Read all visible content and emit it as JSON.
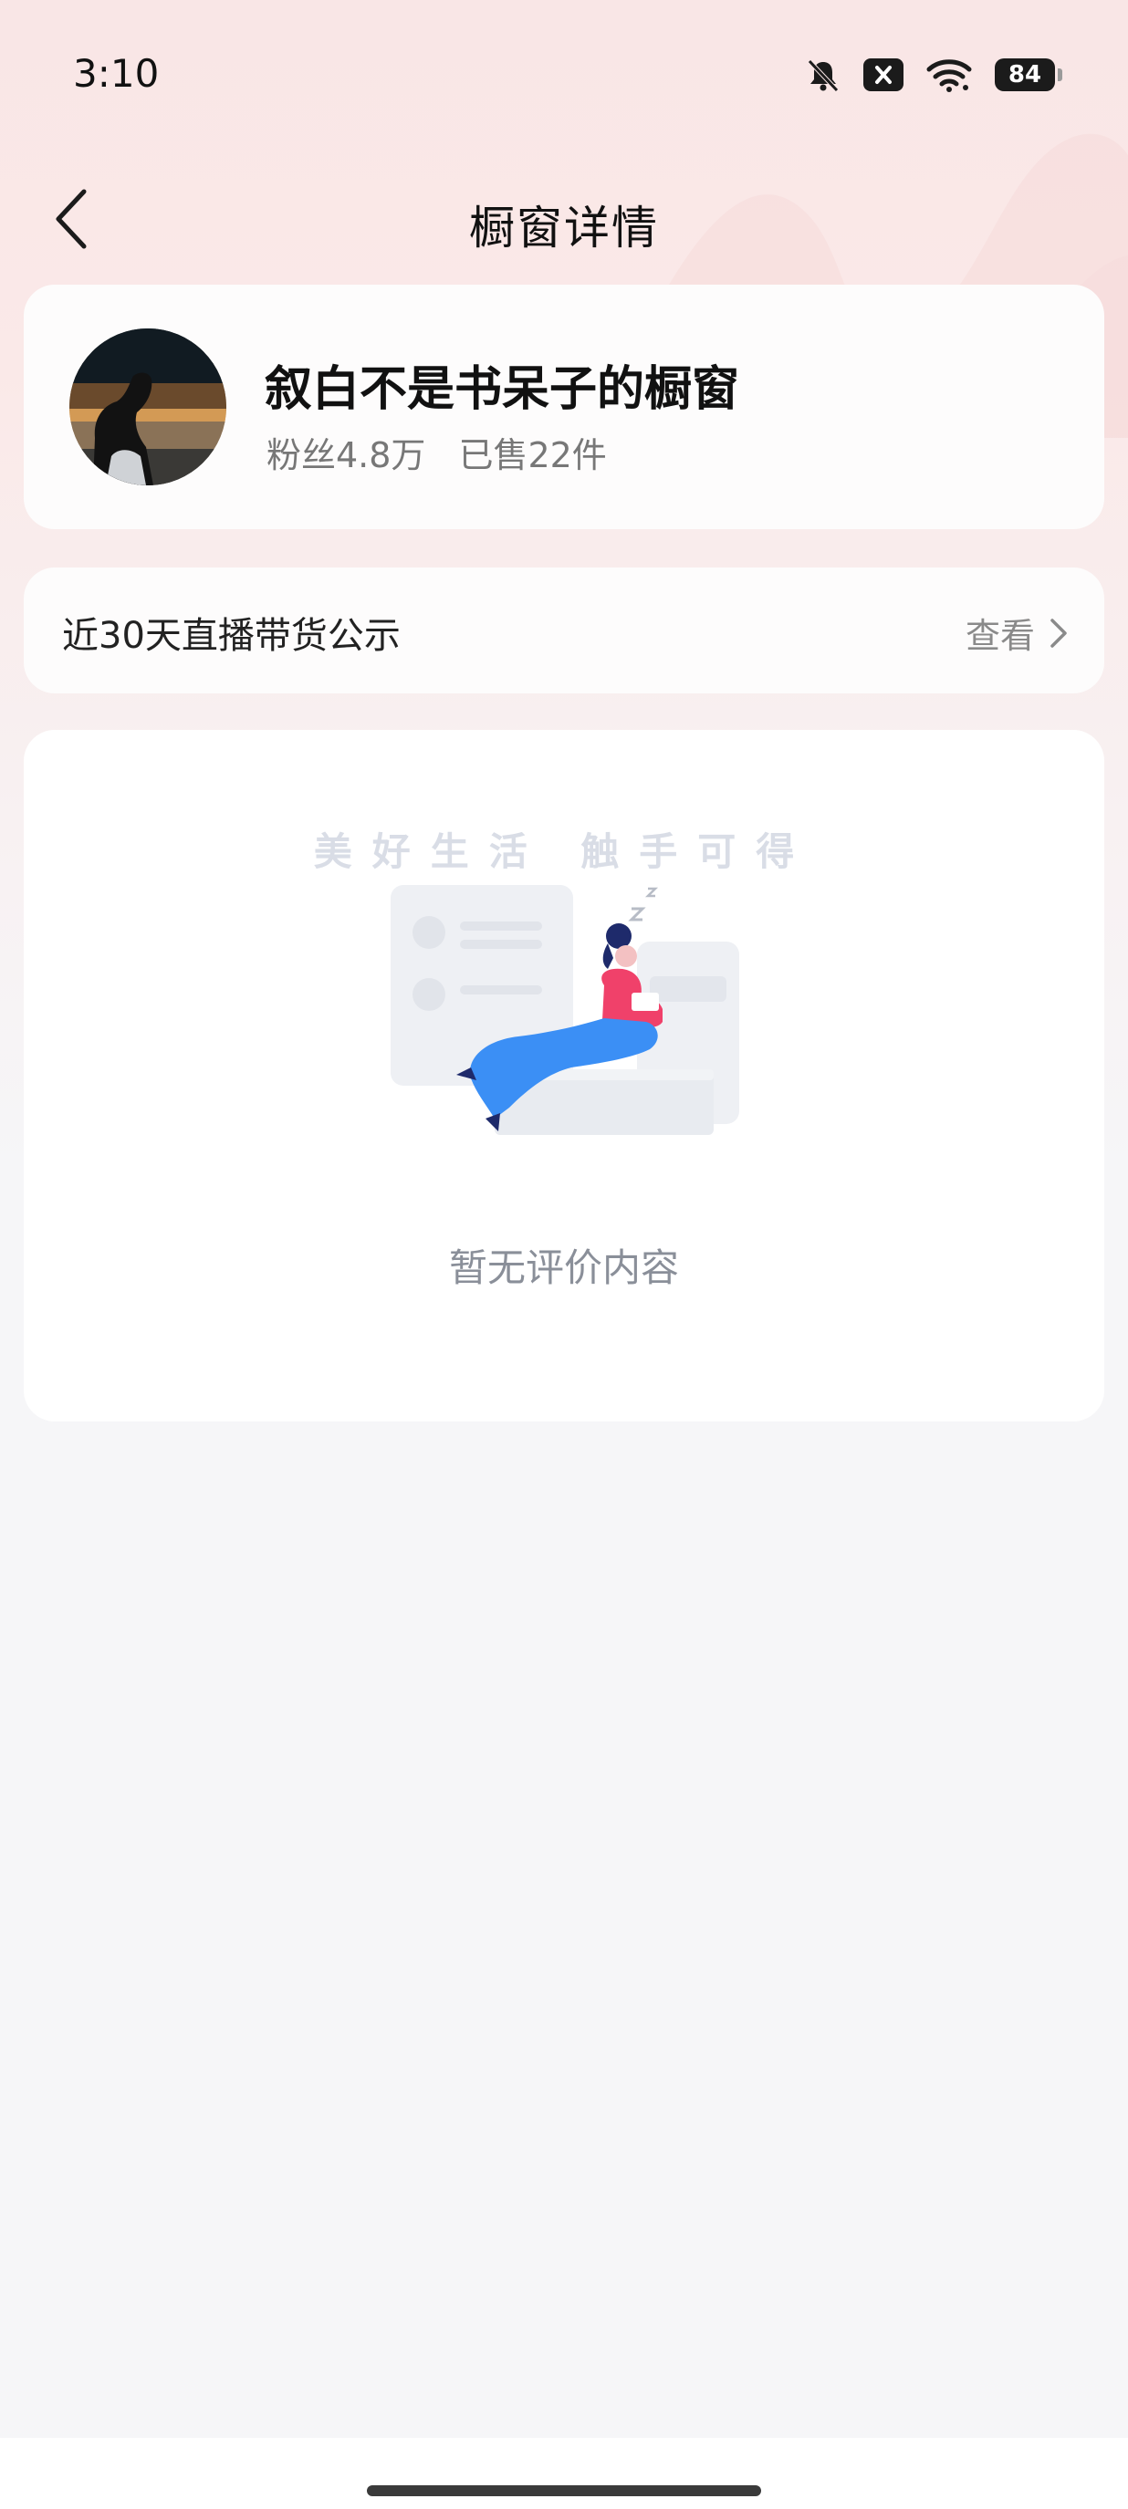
{
  "status_bar": {
    "time": "3:10",
    "battery": "84",
    "icons": [
      "bell-muted-icon",
      "close-box-icon",
      "wifi-icon",
      "battery-icon"
    ]
  },
  "nav": {
    "title": "橱窗详情",
    "back_icon": "chevron-left-icon"
  },
  "store": {
    "name": "叙白不是书呆子的橱窗",
    "fans": "粉丝4.8万",
    "sold": "已售22件"
  },
  "notice": {
    "label": "近30天直播带货公示",
    "link_text": "查看",
    "link_icon": "chevron-right-icon"
  },
  "reviews": {
    "slogan": "美好生活 触手可得",
    "empty_text": "暂无评价内容"
  },
  "colors": {
    "accent_pink": "#f0416a",
    "illustration_blue": "#3b8ff5",
    "text_secondary": "#777777"
  }
}
